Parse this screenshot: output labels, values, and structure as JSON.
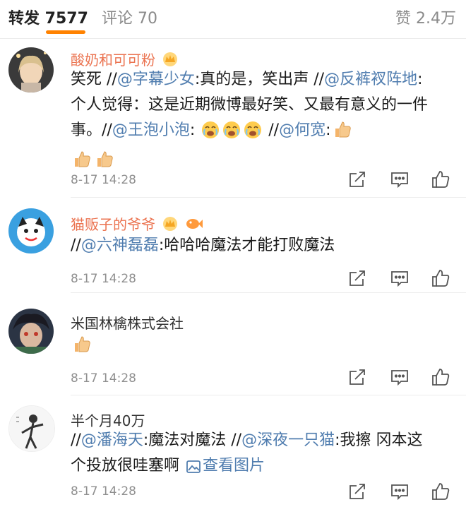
{
  "header": {
    "repost_tab": "转发 7577",
    "comment_tab": "评论 70",
    "likes": "赞 2.4万"
  },
  "comments": [
    {
      "name": "酸奶和可可粉",
      "parts": {
        "p1": "笑死 //",
        "m1": "@字幕少女",
        "p2": ":真的是，笑出声 //",
        "m2": "@反裤衩阵地",
        "p3": ":个人觉得：这是近期微博最好笑、又最有意义的一件事。//",
        "m3": "@王泡小泡",
        "p4": ": ",
        "p5": " //",
        "m4": "@何宽",
        "p6": ":"
      },
      "time": "8-17 14:28"
    },
    {
      "name": "猫贩子的爷爷",
      "parts": {
        "p1": "//",
        "m1": "@六神磊磊",
        "p2": ":哈哈哈魔法才能打败魔法"
      },
      "time": "8-17 14:28"
    },
    {
      "name": "米国林檎株式会社",
      "time": "8-17 14:28"
    },
    {
      "name": "半个月40万",
      "parts": {
        "p1": "//",
        "m1": "@潘海天",
        "p2": ":魔法对魔法 //",
        "m2": "@深夜一只猫",
        "p3": ":我擦 冈本这个投放很哇塞啊 ",
        "link": "查看图片"
      },
      "time": "8-17 14:28"
    }
  ],
  "icons": [
    "repost-icon",
    "comment-icon",
    "like-icon",
    "thumbs-up-emoji",
    "cry-laugh-emoji",
    "crown-badge",
    "fish-badge",
    "picture-icon"
  ],
  "colors": {
    "accent": "#ff8200",
    "mention": "#507daf",
    "vip_name": "#eb7350",
    "meta": "#8f8f8f"
  }
}
